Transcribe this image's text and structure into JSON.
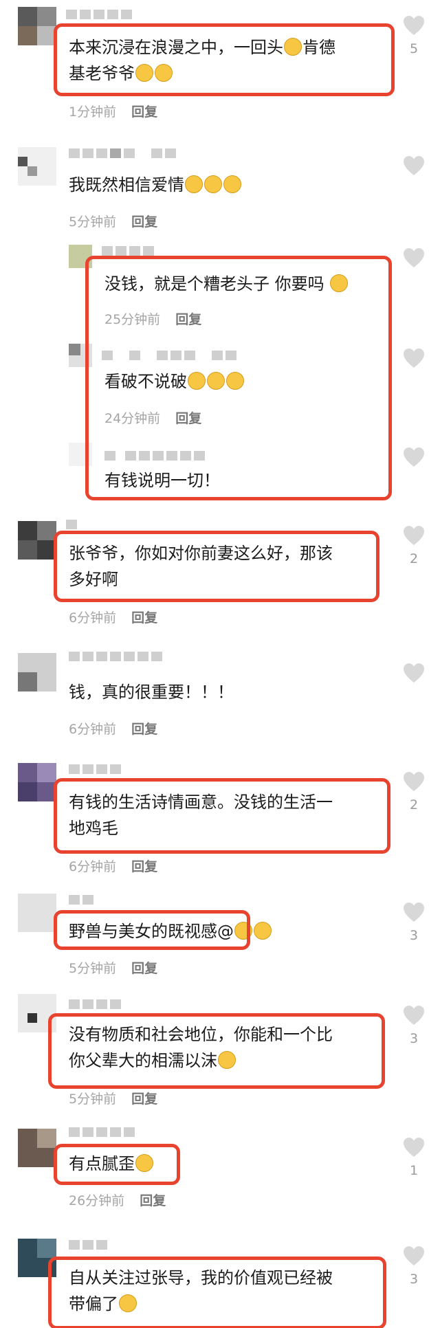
{
  "comments": [
    {
      "text": "本来沉浸在浪漫之中，一回头",
      "text2": "肯德",
      "text3": "基老爷爷",
      "time": "1分钟前",
      "reply": "回复",
      "likes": "5"
    },
    {
      "text": "我既然相信爱情",
      "time": "5分钟前",
      "reply": "回复",
      "likes": ""
    },
    {
      "text": "没钱，就是个糟老头子 你要吗",
      "time": "25分钟前",
      "reply": "回复",
      "likes": ""
    },
    {
      "text": "看破不说破",
      "time": "24分钟前",
      "reply": "回复",
      "likes": ""
    },
    {
      "text": "有钱说明一切！",
      "likes": ""
    },
    {
      "text": "张爷爷，你如对你前妻这么好，那该",
      "text2": "多好啊",
      "time": "6分钟前",
      "reply": "回复",
      "likes": "2"
    },
    {
      "text": "钱，真的很重要！！！",
      "time": "6分钟前",
      "reply": "回复",
      "likes": ""
    },
    {
      "text": "有钱的生活诗情画意。没钱的生活一",
      "text2": "地鸡毛",
      "time": "6分钟前",
      "reply": "回复",
      "likes": "2"
    },
    {
      "text": "野兽与美女的既视感@",
      "time": "5分钟前",
      "reply": "回复",
      "likes": "3"
    },
    {
      "text": "没有物质和社会地位，你能和一个比",
      "text2": "你父辈大的相濡以沫",
      "time": "5分钟前",
      "reply": "回复",
      "likes": "3"
    },
    {
      "text": "有点腻歪",
      "time": "26分钟前",
      "reply": "回复",
      "likes": "1"
    },
    {
      "text": "自从关注过张导，我的价值观已经被",
      "text2": "带偏了",
      "likes": "3"
    }
  ],
  "colors": {
    "highlight": "#e8432f",
    "heart": "#d8d8d8",
    "emoji": "#f7c744"
  }
}
